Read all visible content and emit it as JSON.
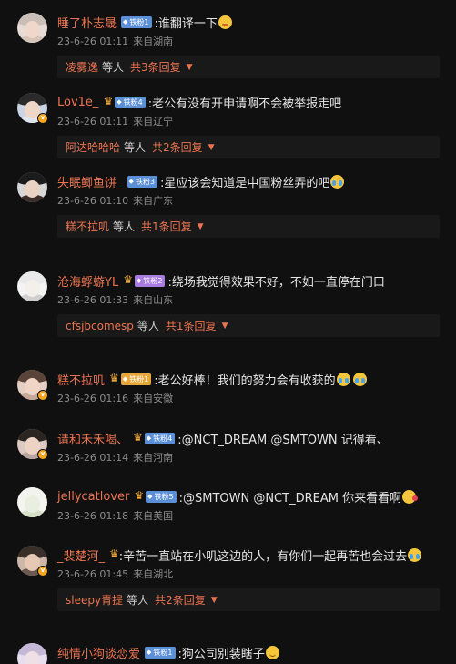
{
  "comments": [
    {
      "username": "睡了朴志晟",
      "badge_label": "铁粉1",
      "badge_color": "blue",
      "crown": false,
      "text": ":谁翻译一下",
      "emoji": "shy",
      "time": "23-6-26 01:11",
      "location": "来自湖南",
      "replies": {
        "name": "凌雾逸",
        "suffix": "等人",
        "count": "共3条回复"
      },
      "avatar": {
        "hair": "#c9bfb7",
        "skin": "#efd8cb",
        "body": "#d7c4b9",
        "bg": "#e7dcd5"
      },
      "verified": false
    },
    {
      "username": "Lov1e_",
      "badge_label": "铁粉4",
      "badge_color": "blue",
      "crown": true,
      "text": ":老公有没有开申请啊不会被举报走吧",
      "emoji": "",
      "time": "23-6-26 01:11",
      "location": "来自辽宁",
      "replies": {
        "name": "阿达哈哈哈",
        "suffix": "等人",
        "count": "共2条回复"
      },
      "avatar": {
        "hair": "#2a2a2a",
        "skin": "#f0d6c6",
        "body": "#dfe5ef",
        "bg": "#cbd4e2"
      },
      "verified": true
    },
    {
      "username": "失眠鲫鱼饼_",
      "badge_label": "铁粉3",
      "badge_color": "blue",
      "crown": false,
      "text": ":星应该会知道是中国粉丝弄的吧",
      "emoji": "cry",
      "time": "23-6-26 01:10",
      "location": "来自广东",
      "replies": {
        "name": "糕不拉叽",
        "suffix": "等人",
        "count": "共1条回复"
      },
      "avatar": {
        "hair": "#1b1b1b",
        "skin": "#ead2c2",
        "body": "#3b2d2a",
        "bg": "#d7d7d7"
      },
      "verified": false
    },
    {
      "username": "沧海蜉蝣YL",
      "badge_label": "铁粉2",
      "badge_color": "purple",
      "crown": true,
      "text": ":绕场我觉得效果不好，不如一直停在门口",
      "emoji": "",
      "time": "23-6-26 01:33",
      "location": "来自山东",
      "replies": {
        "name": "cfsjbcomesp",
        "suffix": "等人",
        "count": "共1条回复"
      },
      "avatar": {
        "hair": "#e9e9e9",
        "skin": "#f3efea",
        "body": "#cfcfcf",
        "bg": "#f4f4f4"
      },
      "verified": false
    },
    {
      "username": "糕不拉叽",
      "badge_label": "铁粉1",
      "badge_color": "gold",
      "crown": true,
      "text": ":老公好棒！我们的努力会有收获的",
      "emoji": "cry2",
      "time": "23-6-26 01:16",
      "location": "来自安徽",
      "replies": null,
      "avatar": {
        "hair": "#5a4338",
        "skin": "#f0d4c4",
        "body": "#c7a99b",
        "bg": "#e3cfc4"
      },
      "verified": true
    },
    {
      "username": "请和禾禾喝、",
      "badge_label": "铁粉4",
      "badge_color": "blue",
      "crown": true,
      "text": ":@NCT_DREAM @SMTOWN 记得看、",
      "emoji": "",
      "time": "23-6-26 01:14",
      "location": "来自河南",
      "replies": null,
      "avatar": {
        "hair": "#2b2522",
        "skin": "#ecd3c4",
        "body": "#b9a6a0",
        "bg": "#dccac2"
      },
      "verified": true
    },
    {
      "username": "jellycatlover",
      "badge_label": "铁粉5",
      "badge_color": "blue",
      "crown": true,
      "text": ":@SMTOWN @NCT_DREAM 你来看看啊",
      "emoji": "kiss",
      "time": "23-6-26 01:18",
      "location": "来自美国",
      "replies": null,
      "avatar": {
        "hair": "#f2f2ee",
        "skin": "#e9efe0",
        "body": "#d6e0c9",
        "bg": "#f3f5ee"
      },
      "verified": false
    },
    {
      "username": "_裴楚河_",
      "badge_label": "",
      "badge_color": "",
      "crown": true,
      "text": ":辛苦一直站在小叽这边的人，有你们一起再苦也会过去",
      "emoji": "cry",
      "time": "23-6-26 01:45",
      "location": "来自湖北",
      "replies": {
        "name": "sleepy青提",
        "suffix": "等人",
        "count": "共2条回复"
      },
      "avatar": {
        "hair": "#3a2e28",
        "skin": "#e6c8b4",
        "body": "#6b5a50",
        "bg": "#cdb7a8"
      },
      "verified": true
    },
    {
      "username": "纯情小狗谈恋爱",
      "badge_label": "铁粉1",
      "badge_color": "blue",
      "crown": false,
      "text": ":狗公司别装瞎子",
      "emoji": "smile",
      "time": "",
      "location": "",
      "replies": null,
      "avatar": {
        "hair": "#c5b8d7",
        "skin": "#efe0e6",
        "body": "#d8cce3",
        "bg": "#e7dff0"
      },
      "verified": false
    }
  ]
}
